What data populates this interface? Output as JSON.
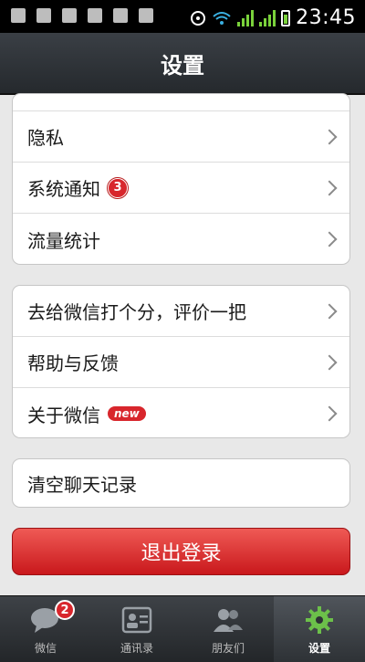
{
  "status_bar": {
    "time": "23:45"
  },
  "header": {
    "title": "设置"
  },
  "group1": {
    "items": [
      {
        "label": "隐私"
      },
      {
        "label": "系统通知",
        "badge": "3"
      },
      {
        "label": "流量统计"
      }
    ]
  },
  "group2": {
    "items": [
      {
        "label": "去给微信打个分，评价一把"
      },
      {
        "label": "帮助与反馈"
      },
      {
        "label": "关于微信",
        "badge": "new"
      }
    ]
  },
  "group3": {
    "items": [
      {
        "label": "清空聊天记录"
      }
    ]
  },
  "logout": {
    "label": "退出登录"
  },
  "tabbar": {
    "tabs": [
      {
        "label": "微信",
        "badge": "2"
      },
      {
        "label": "通讯录"
      },
      {
        "label": "朋友们"
      },
      {
        "label": "设置",
        "active": true
      }
    ]
  },
  "colors": {
    "accent_red": "#d8262c",
    "header_bg": "#2f3338",
    "page_bg": "#e8e8e8"
  }
}
